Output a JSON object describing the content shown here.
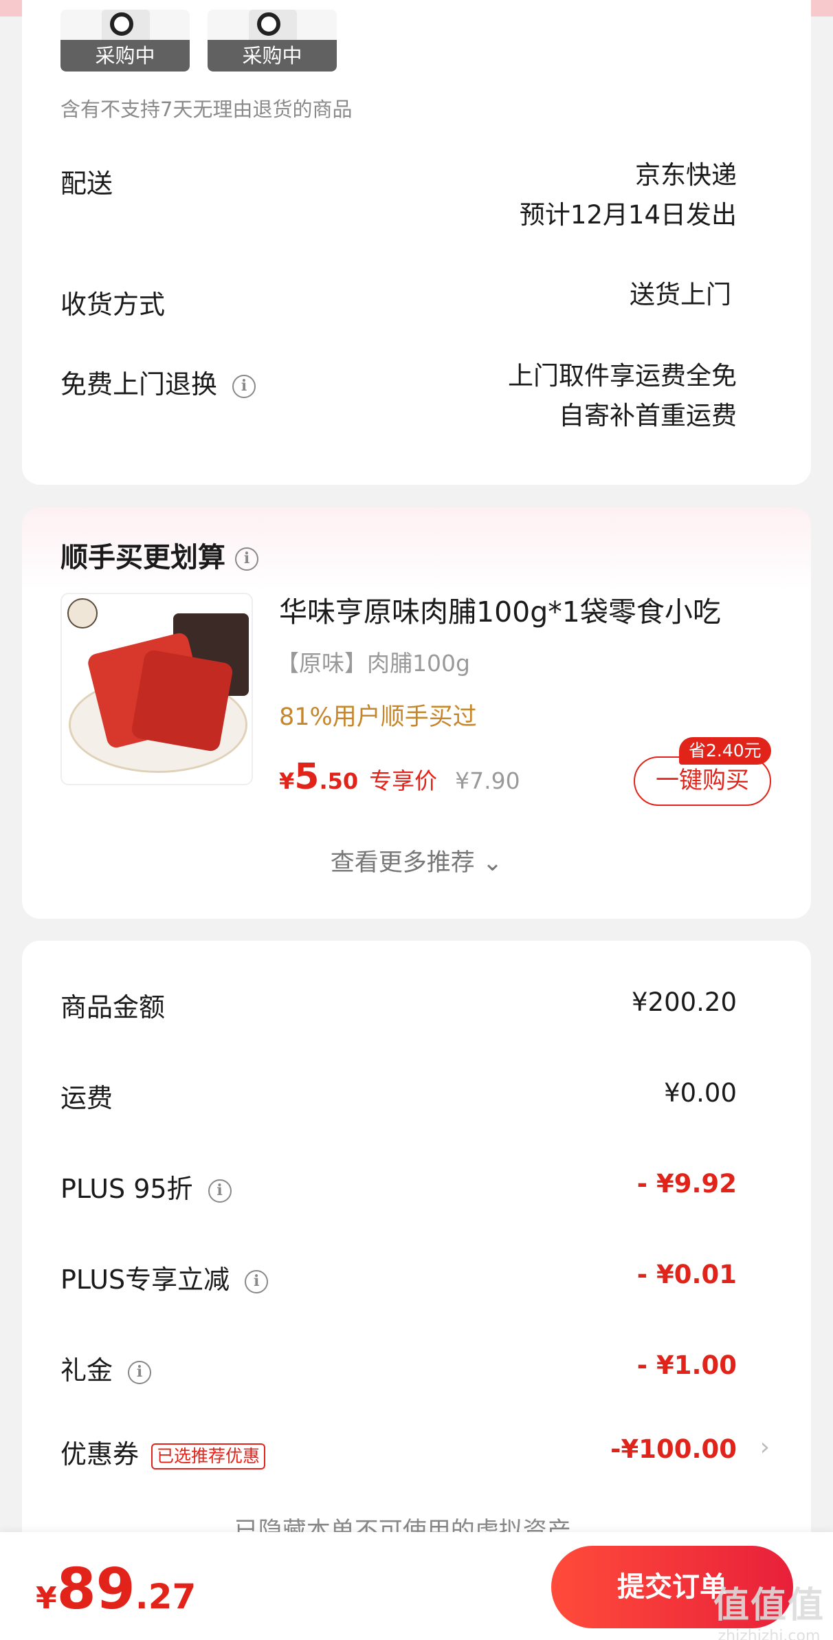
{
  "items": {
    "status_1": "采购中",
    "status_2": "采购中",
    "return_note": "含有不支持7天无理由退货的商品"
  },
  "delivery": {
    "label": "配送",
    "carrier": "京东快递",
    "eta": "预计12月14日发出"
  },
  "receive": {
    "label": "收货方式",
    "value": "送货上门"
  },
  "free_return": {
    "label": "免费上门退换",
    "line1": "上门取件享运费全免",
    "line2": "自寄补首重运费"
  },
  "addon": {
    "title": "顺手买更划算",
    "product_title": "华味亨原味肉脯100g*1袋零食小吃",
    "spec": "【原味】肉脯100g",
    "social_proof": "81%用户顺手买过",
    "price_symbol": "¥",
    "price_int": "5",
    "price_dec": ".50",
    "price_tag": "专享价",
    "original_price": "¥7.90",
    "save_badge": "省2.40元",
    "buy_label": "一键购买",
    "more_label": "查看更多推荐 ⌄"
  },
  "summary": {
    "goods_amount_label": "商品金额",
    "goods_amount": "¥200.20",
    "shipping_label": "运费",
    "shipping": "¥0.00",
    "plus95_label": "PLUS 95折",
    "plus95": "- ¥9.92",
    "plus_reduce_label": "PLUS专享立减",
    "plus_reduce": "- ¥0.01",
    "gift_label": "礼金",
    "gift": "- ¥1.00",
    "coupon_label": "优惠券",
    "coupon_badge": "已选推荐优惠",
    "coupon": "-¥100.00",
    "hidden_note": "已隐藏本单不可使用的虚拟资产 ⌄"
  },
  "footer": {
    "total_symbol": "¥",
    "total_int": "89",
    "total_dec": ".27",
    "submit_label": "提交订单"
  },
  "watermark": {
    "mark": "值值值",
    "domain": "zhizhizhi.com"
  },
  "icons": {
    "info": "info-icon",
    "chevron_right": "chevron-right-icon"
  },
  "colors": {
    "accent": "#e2231a",
    "social": "#c7862a"
  }
}
